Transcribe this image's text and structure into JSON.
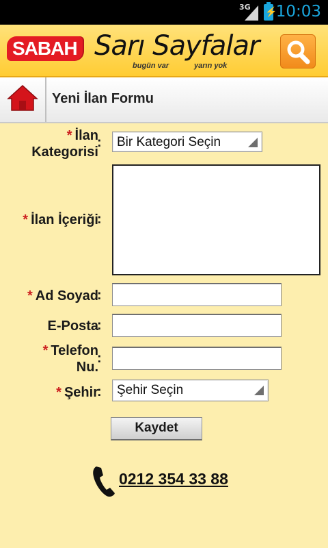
{
  "status_bar": {
    "network": "3G",
    "time": "10:03"
  },
  "header": {
    "brand": "SABAH",
    "product": "Sarı Sayfalar",
    "tagline_left": "bugün var",
    "tagline_right": "yarın yok"
  },
  "titlebar": {
    "title": "Yeni İlan Formu"
  },
  "form": {
    "required_mark": "*",
    "colon": ":",
    "category": {
      "label_line1": "İlan",
      "label_line2": "Kategorisi",
      "value": "Bir Kategori Seçin"
    },
    "content": {
      "label": "İlan İçeriği",
      "value": ""
    },
    "name": {
      "label": "Ad Soyad",
      "value": ""
    },
    "email": {
      "label": "E-Posta",
      "value": ""
    },
    "phone": {
      "label_line1": "Telefon",
      "label_line2": "Nu.",
      "value": ""
    },
    "city": {
      "label": "Şehir",
      "value": "Şehir Seçin"
    },
    "save_label": "Kaydet"
  },
  "contact": {
    "phone_number": "0212 354 33 88"
  },
  "colors": {
    "background": "#fdeeae",
    "header": "#ffcc33",
    "brand_red": "#e41b23",
    "required_star": "#cc1f1f",
    "status_accent": "#1aa6dc"
  },
  "icons": [
    "signal-icon",
    "battery-icon",
    "search-icon",
    "home-icon",
    "dropdown-arrow-icon",
    "phone-icon"
  ]
}
